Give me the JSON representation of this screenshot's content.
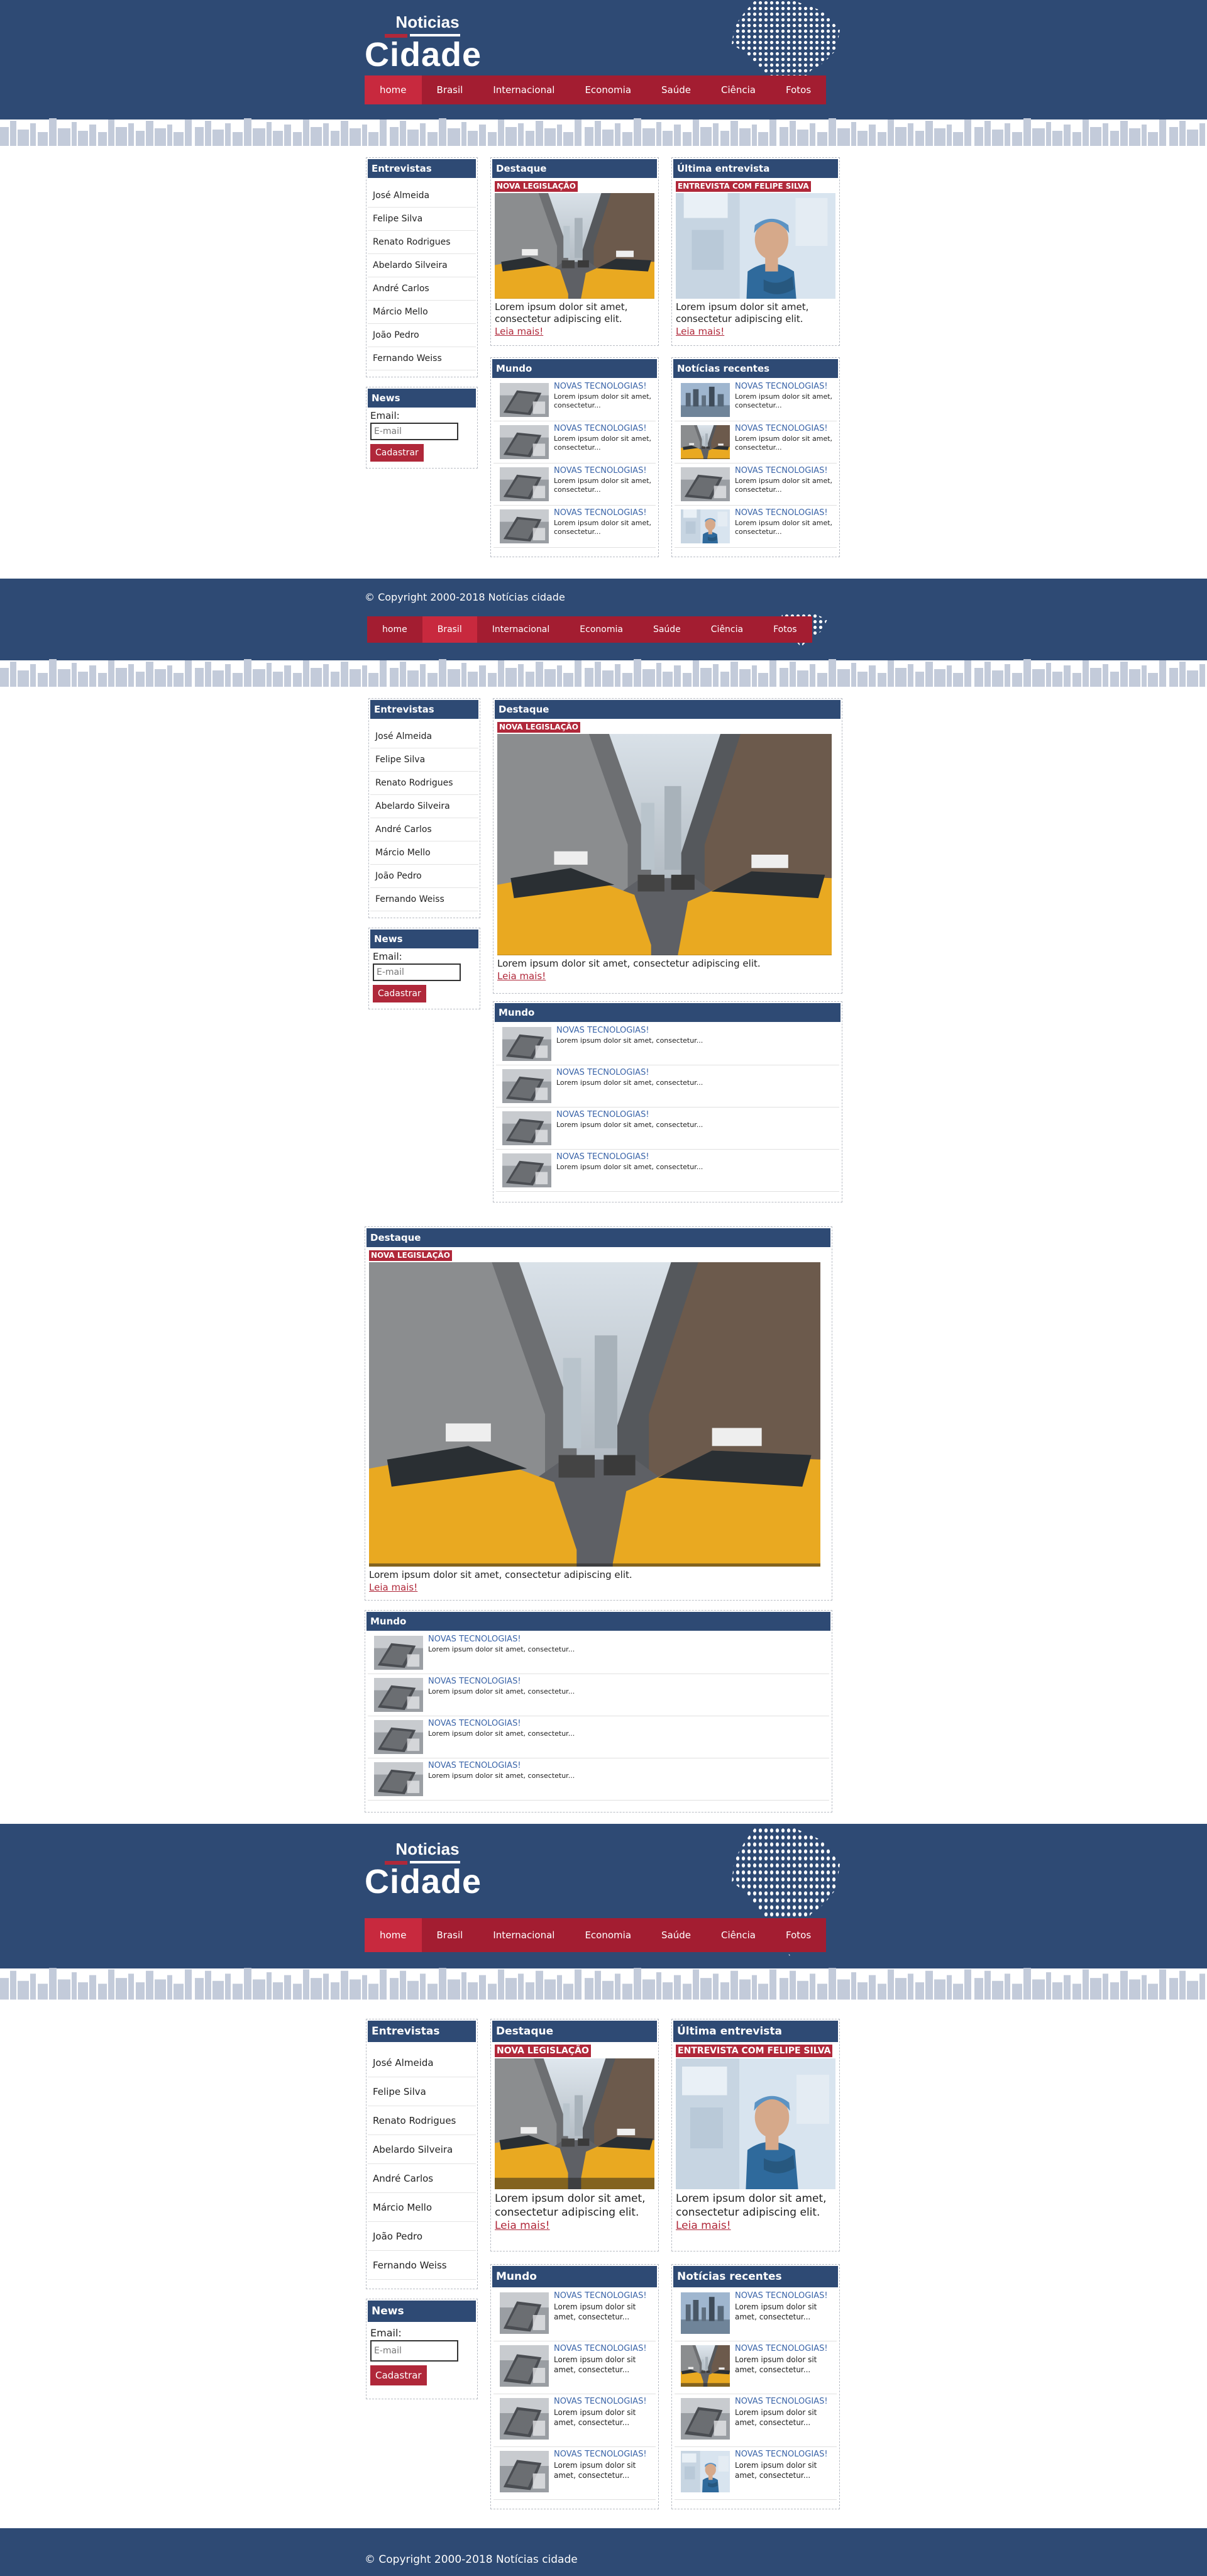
{
  "site": {
    "logo_small": "Noticias",
    "logo_big": "Cidade",
    "copyright": "© Copyright 2000-2018 Notícias cidade"
  },
  "nav": [
    {
      "label": "home"
    },
    {
      "label": "Brasil"
    },
    {
      "label": "Internacional"
    },
    {
      "label": "Economia"
    },
    {
      "label": "Saúde"
    },
    {
      "label": "Ciência"
    },
    {
      "label": "Fotos"
    }
  ],
  "sidebar": {
    "title": "Entrevistas",
    "items": [
      "José Almeida",
      "Felipe Silva",
      "Renato Rodrigues",
      "Abelardo Silveira",
      "André Carlos",
      "Márcio Mello",
      "João Pedro",
      "Fernando Weiss"
    ]
  },
  "newsletter": {
    "title": "News",
    "label": "Email:",
    "placeholder": "E-mail",
    "button": "Cadastrar"
  },
  "destaque": {
    "title": "Destaque",
    "tag": "NOVA LEGISLAÇÃO",
    "text": "Lorem ipsum dolor sit amet, consectetur adipiscing elit.",
    "more": "Leia mais!"
  },
  "entrevista": {
    "title": "Última entrevista",
    "tag": "ENTREVISTA COM FELIPE SILVA",
    "text": "Lorem ipsum dolor sit amet, consectetur adipiscing elit.",
    "more": "Leia mais!"
  },
  "mundo": {
    "title": "Mundo",
    "item_title": "NOVAS TECNOLOGIAS!",
    "item_text": "Lorem ipsum dolor sit amet, consectetur...",
    "count": 4
  },
  "recentes": {
    "title": "Notícias recentes",
    "item_title": "NOVAS TECNOLOGIAS!",
    "item_text": "Lorem ipsum dolor sit amet, consectetur...",
    "count": 4
  },
  "colors": {
    "navy": "#2e4a74",
    "red": "#a31d31",
    "red_active": "#c8293e",
    "link_blue": "#3a64a8"
  }
}
